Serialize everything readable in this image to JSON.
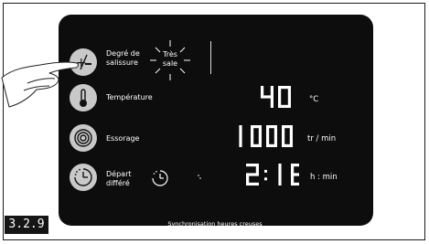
{
  "figure_label": "3.2.9",
  "buttons": [
    {
      "id": "soil",
      "label": "Degré de\nsalissure",
      "icon": "plus-minus-icon"
    },
    {
      "id": "temperature",
      "label": "Température",
      "icon": "thermometer-icon"
    },
    {
      "id": "spin",
      "label": "Essorage",
      "icon": "spiral-icon"
    },
    {
      "id": "delay",
      "label": "Départ\ndifféré",
      "icon": "clock-icon"
    }
  ],
  "soil_level": "Très\nsale",
  "display": {
    "temperature": {
      "value": "40",
      "unit": "°C"
    },
    "spin": {
      "value": "1000",
      "unit": "tr / min"
    },
    "delay": {
      "value": "2: 16",
      "unit": "h : min"
    }
  },
  "footer_text": "Synchronisation heures creuses",
  "colors": {
    "panel": "#0d0d0d",
    "button": "#c9c9c9",
    "text": "#ffffff"
  }
}
